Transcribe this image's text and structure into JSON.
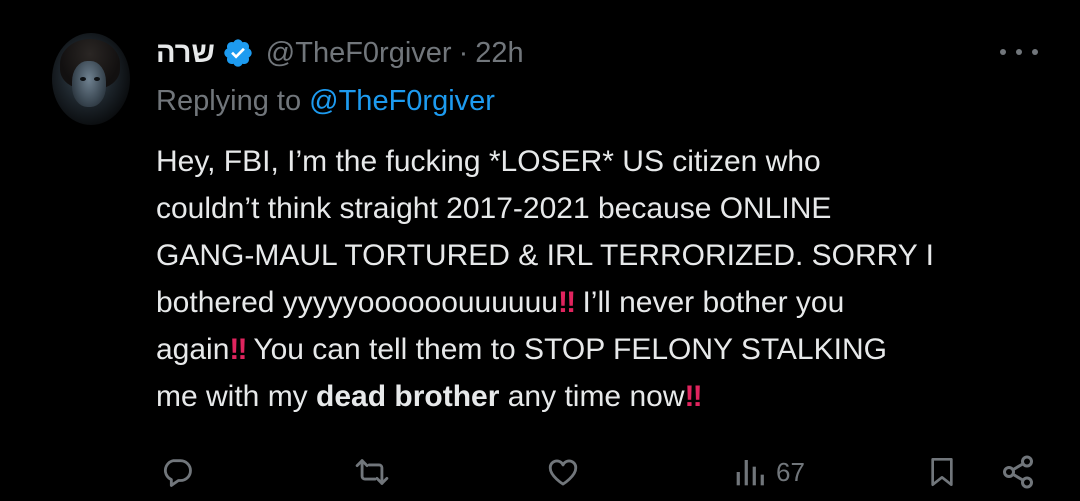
{
  "tweet": {
    "author": {
      "display_name": "שרה",
      "handle": "@TheF0rgiver",
      "verified": true
    },
    "separator": "·",
    "time": "22h",
    "replying_to": {
      "prefix": "Replying to",
      "handle": "@TheF0rgiver"
    },
    "text": {
      "line1": "Hey, FBI, I’m the fucking *LOSER* US citizen who",
      "line2": "couldn’t think straight 2017-2021 because ONLINE",
      "line3": "GANG-MAUL TORTURED & IRL TERRORIZED. SORRY I",
      "line4_a": "bothered yyyyyoooooouuuuuu",
      "line4_b": "I’ll never bother you",
      "line5_a": "again",
      "line5_b": "You can tell them to STOP FELONY STALKING",
      "line6_a": "me with my",
      "line6_bold": "dead brother",
      "line6_b": "any time now",
      "emphasis_glyph": "‼"
    },
    "actions": {
      "reply_icon": "reply-icon",
      "repost_icon": "repost-icon",
      "like_icon": "heart-icon",
      "views_icon": "views-icon",
      "views_count": "67",
      "bookmark_icon": "bookmark-icon",
      "share_icon": "share-icon"
    }
  },
  "colors": {
    "background": "#000000",
    "text_primary": "#e7e9ea",
    "text_secondary": "#71767b",
    "link": "#1d9bf0",
    "verified_badge": "#1d9bf0",
    "emphasis": "#e0245e"
  }
}
